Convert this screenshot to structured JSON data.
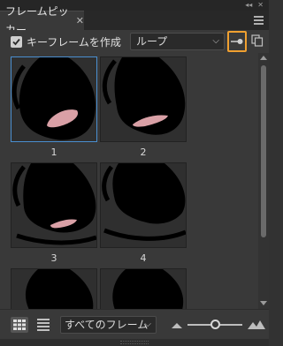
{
  "panel": {
    "collapse_glyph": "◂◂",
    "close_glyph": "✕",
    "tab_title": "フレームピッカー",
    "tab_close": "✕"
  },
  "toolbar": {
    "keyframe_checkbox_checked": true,
    "keyframe_label": "キーフレームを作成",
    "loop_select_value": "ループ",
    "loop_select_chevron": "⌵",
    "pin_active": true
  },
  "frames": [
    {
      "label": "1",
      "selected": true,
      "mouth": "open-wide"
    },
    {
      "label": "2",
      "selected": false,
      "mouth": "open-narrow"
    },
    {
      "label": "3",
      "selected": false,
      "mouth": "open-small"
    },
    {
      "label": "4",
      "selected": false,
      "mouth": "closed"
    },
    {
      "label": "",
      "selected": false,
      "mouth": "partial"
    },
    {
      "label": "",
      "selected": false,
      "mouth": "partial"
    }
  ],
  "bottom": {
    "filter_value": "すべてのフレーム",
    "filter_chevron": "⌵",
    "thumbnail_size_fraction": 0.5
  },
  "colors": {
    "accent_orange": "#f0a030",
    "selection_blue": "#4a8fd0",
    "tongue_pink": "#d9a0a6"
  }
}
